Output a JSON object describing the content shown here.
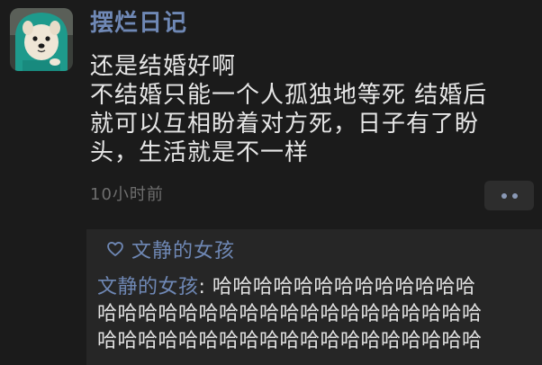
{
  "post": {
    "author": "摆烂日记",
    "lines": [
      "还是结婚好啊",
      "不结婚只能一个人孤独地等死  结婚后",
      "就可以互相盼着对方死，日子有了盼",
      "头，生活就是不一样"
    ],
    "timestamp": "10小时前"
  },
  "likes": {
    "icon": "heart-outline-icon",
    "names": "文静的女孩"
  },
  "comment": {
    "author": "文静的女孩",
    "separator": ": ",
    "first_line_text": "哈哈哈哈哈哈哈哈哈哈哈哈哈",
    "lines": [
      "哈哈哈哈哈哈哈哈哈哈哈哈哈哈哈哈哈哈哈",
      "哈哈哈哈哈哈哈哈哈哈哈哈哈哈哈哈哈哈哈"
    ]
  },
  "colors": {
    "background": "#1b1b1b",
    "panel": "#262626",
    "name_blue": "#6f88b5",
    "text": "#e6e6e6",
    "timestamp": "#6e6e6e"
  }
}
